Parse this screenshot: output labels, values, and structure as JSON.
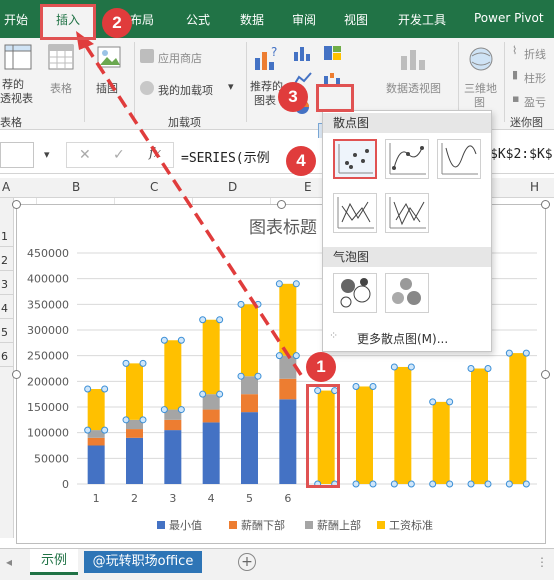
{
  "ribbon_tabs": {
    "start": "开始",
    "insert": "插入",
    "layout_partial": "布局",
    "formulas": "公式",
    "data": "数据",
    "review": "审阅",
    "view": "视图",
    "developer": "开发工具",
    "power_pivot": "Power Pivot"
  },
  "ribbon": {
    "recommended_pivot_line1": "荐的",
    "recommended_pivot_line2": "透视表",
    "table": "表格",
    "illustrations": "插图",
    "group_tables": "表格",
    "app_store": "应用商店",
    "my_addins": "我的加载项",
    "group_addins": "加载项",
    "recommended_chart_line1": "推荐的",
    "recommended_chart_line2": "图表",
    "pivot_chart": "数据透视图",
    "map_3d_line1": "三维地",
    "map_3d_line2": "图",
    "sparkline_line": "折线",
    "sparkline_column": "柱形",
    "sparkline_winloss": "盈亏",
    "group_sparklines": "迷你图"
  },
  "formula_bar": {
    "formula_left": "=SERIES(示例",
    "formula_right": "$K$2:$K$",
    "fx": "fx"
  },
  "columns": [
    "A",
    "B",
    "C",
    "D",
    "E",
    "H"
  ],
  "rows": [
    "1",
    "2",
    "3",
    "4",
    "5",
    "6"
  ],
  "dropdown": {
    "scatter_header": "散点图",
    "bubble_header": "气泡图",
    "more_scatter": "更多散点图(M)..."
  },
  "sheet_tabs": {
    "example": "示例",
    "second": "@玩转职场office"
  },
  "badges": [
    "1",
    "2",
    "3",
    "4"
  ],
  "colors": {
    "excel_green": "#217346",
    "series_min": "#4472c4",
    "series_low": "#ed7d31",
    "series_high": "#a5a5a5",
    "series_standard": "#ffc000",
    "annotation_red": "#e03c3c"
  },
  "chart_data": {
    "type": "bar",
    "stacked": true,
    "title": "图表标题",
    "categories": [
      "1",
      "2",
      "3",
      "4",
      "5",
      "6",
      "",
      "",
      "",
      "",
      "",
      ""
    ],
    "series": [
      {
        "name": "最小值",
        "values": [
          75000,
          90000,
          105000,
          120000,
          140000,
          165000,
          0,
          0,
          0,
          0,
          0,
          0
        ]
      },
      {
        "name": "薪酬下部",
        "values": [
          15000,
          17000,
          20000,
          25000,
          35000,
          40000,
          0,
          0,
          0,
          0,
          0,
          0
        ]
      },
      {
        "name": "薪酬上部",
        "values": [
          15000,
          18000,
          20000,
          30000,
          35000,
          45000,
          0,
          0,
          0,
          0,
          0,
          0
        ]
      },
      {
        "name": "工资标准",
        "values": [
          80000,
          110000,
          135000,
          145000,
          140000,
          140000,
          182000,
          190000,
          228000,
          160000,
          225000,
          255000
        ]
      }
    ],
    "ylim": [
      0,
      450000
    ],
    "yticks": [
      "0",
      "50000",
      "100000",
      "150000",
      "200000",
      "250000",
      "300000",
      "350000",
      "400000",
      "450000"
    ],
    "xlabel": "",
    "ylabel": "",
    "grid": true,
    "legend": "bottom"
  }
}
